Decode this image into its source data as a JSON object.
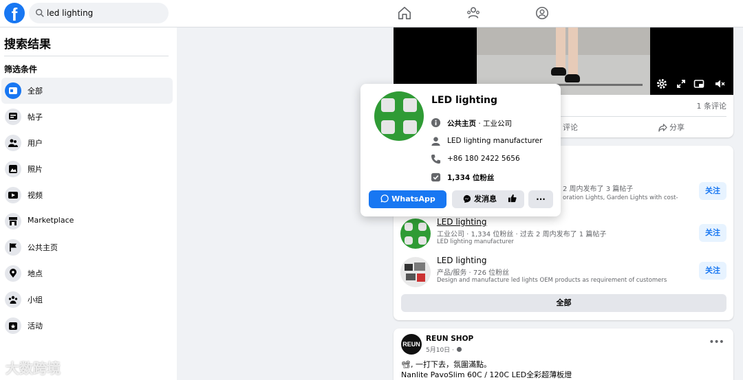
{
  "header": {
    "logo": "f",
    "search_value": "led lighting",
    "nav_icons": [
      "home-icon",
      "friends-icon",
      "groups-icon"
    ]
  },
  "sidebar": {
    "title": "搜索结果",
    "filter_title": "筛选条件",
    "items": [
      {
        "label": "全部",
        "icon": "feed-icon",
        "active": true
      },
      {
        "label": "帖子",
        "icon": "posts-icon"
      },
      {
        "label": "用户",
        "icon": "people-icon"
      },
      {
        "label": "照片",
        "icon": "photo-icon"
      },
      {
        "label": "视频",
        "icon": "video-icon"
      },
      {
        "label": "Marketplace",
        "icon": "marketplace-icon"
      },
      {
        "label": "公共主页",
        "icon": "flag-icon"
      },
      {
        "label": "地点",
        "icon": "location-icon"
      },
      {
        "label": "小组",
        "icon": "groups-icon"
      },
      {
        "label": "活动",
        "icon": "event-icon"
      }
    ]
  },
  "video_post": {
    "comment_count": "1 条评论",
    "comment_label": "评论",
    "share_label": "分享"
  },
  "popup": {
    "title": "LED lighting",
    "type_bold": "公共主页",
    "type_rest": " · 工业公司",
    "description": "LED lighting manufacturer",
    "phone": "+86 180 2422 5656",
    "followers": "1,334 位粉丝",
    "whatsapp_label": "WhatsApp",
    "message_label": "发消息",
    "more_label": "···"
  },
  "pages": {
    "partial_row": {
      "meta": "2 周内发布了 3 篇帖子",
      "desc": "oration Lights, Garden Lights with cost-",
      "follow": "关注"
    },
    "rows": [
      {
        "name": "LED lighting",
        "meta": "工业公司 · 1,334 位粉丝 · 过去 2 周内发布了 1 篇帖子",
        "desc": "LED lighting manufacturer",
        "follow": "关注"
      },
      {
        "name": "LED lighting",
        "meta": "产品/服务 · 726 位粉丝",
        "desc": "Design and manufacture led lights OEM products as requirement of customers",
        "follow": "关注"
      }
    ],
    "all_label": "全部"
  },
  "post": {
    "avatar_text": "REUN",
    "author": "REUN SHOP",
    "date": "5月10日 · ",
    "line1": "📽, 一打下去，氛圍滿點。",
    "line2": "Nanlite PavoSlim 60C / 120C LED全彩超薄板燈"
  },
  "watermark": "大数跨境",
  "colors": {
    "accent": "#1877f2",
    "follow_bg": "#e7f3ff",
    "page_bg": "#f0f2f5"
  }
}
